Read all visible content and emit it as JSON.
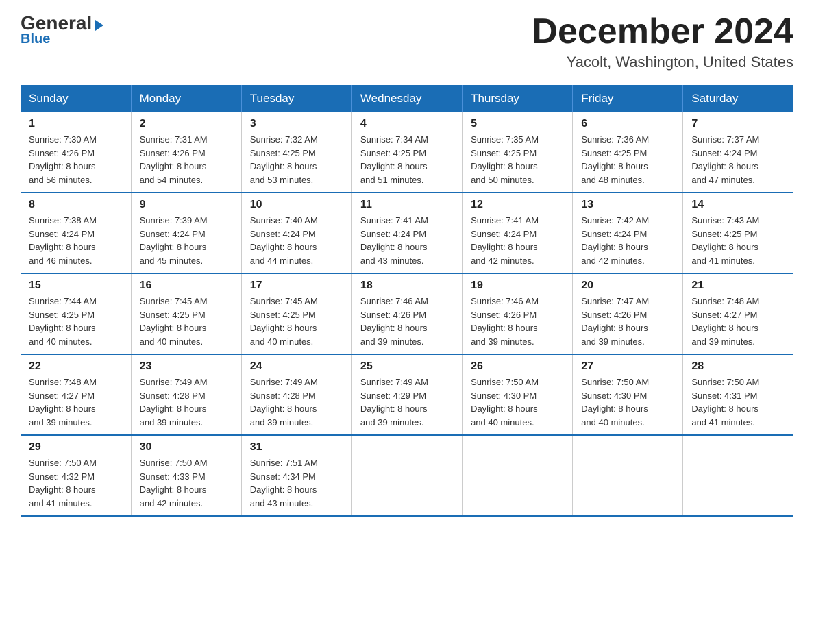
{
  "header": {
    "logo_general": "General",
    "logo_blue": "Blue",
    "month_title": "December 2024",
    "location": "Yacolt, Washington, United States"
  },
  "days_of_week": [
    "Sunday",
    "Monday",
    "Tuesday",
    "Wednesday",
    "Thursday",
    "Friday",
    "Saturday"
  ],
  "weeks": [
    [
      {
        "day": "1",
        "sunrise": "7:30 AM",
        "sunset": "4:26 PM",
        "daylight": "8 hours and 56 minutes."
      },
      {
        "day": "2",
        "sunrise": "7:31 AM",
        "sunset": "4:26 PM",
        "daylight": "8 hours and 54 minutes."
      },
      {
        "day": "3",
        "sunrise": "7:32 AM",
        "sunset": "4:25 PM",
        "daylight": "8 hours and 53 minutes."
      },
      {
        "day": "4",
        "sunrise": "7:34 AM",
        "sunset": "4:25 PM",
        "daylight": "8 hours and 51 minutes."
      },
      {
        "day": "5",
        "sunrise": "7:35 AM",
        "sunset": "4:25 PM",
        "daylight": "8 hours and 50 minutes."
      },
      {
        "day": "6",
        "sunrise": "7:36 AM",
        "sunset": "4:25 PM",
        "daylight": "8 hours and 48 minutes."
      },
      {
        "day": "7",
        "sunrise": "7:37 AM",
        "sunset": "4:24 PM",
        "daylight": "8 hours and 47 minutes."
      }
    ],
    [
      {
        "day": "8",
        "sunrise": "7:38 AM",
        "sunset": "4:24 PM",
        "daylight": "8 hours and 46 minutes."
      },
      {
        "day": "9",
        "sunrise": "7:39 AM",
        "sunset": "4:24 PM",
        "daylight": "8 hours and 45 minutes."
      },
      {
        "day": "10",
        "sunrise": "7:40 AM",
        "sunset": "4:24 PM",
        "daylight": "8 hours and 44 minutes."
      },
      {
        "day": "11",
        "sunrise": "7:41 AM",
        "sunset": "4:24 PM",
        "daylight": "8 hours and 43 minutes."
      },
      {
        "day": "12",
        "sunrise": "7:41 AM",
        "sunset": "4:24 PM",
        "daylight": "8 hours and 42 minutes."
      },
      {
        "day": "13",
        "sunrise": "7:42 AM",
        "sunset": "4:24 PM",
        "daylight": "8 hours and 42 minutes."
      },
      {
        "day": "14",
        "sunrise": "7:43 AM",
        "sunset": "4:25 PM",
        "daylight": "8 hours and 41 minutes."
      }
    ],
    [
      {
        "day": "15",
        "sunrise": "7:44 AM",
        "sunset": "4:25 PM",
        "daylight": "8 hours and 40 minutes."
      },
      {
        "day": "16",
        "sunrise": "7:45 AM",
        "sunset": "4:25 PM",
        "daylight": "8 hours and 40 minutes."
      },
      {
        "day": "17",
        "sunrise": "7:45 AM",
        "sunset": "4:25 PM",
        "daylight": "8 hours and 40 minutes."
      },
      {
        "day": "18",
        "sunrise": "7:46 AM",
        "sunset": "4:26 PM",
        "daylight": "8 hours and 39 minutes."
      },
      {
        "day": "19",
        "sunrise": "7:46 AM",
        "sunset": "4:26 PM",
        "daylight": "8 hours and 39 minutes."
      },
      {
        "day": "20",
        "sunrise": "7:47 AM",
        "sunset": "4:26 PM",
        "daylight": "8 hours and 39 minutes."
      },
      {
        "day": "21",
        "sunrise": "7:48 AM",
        "sunset": "4:27 PM",
        "daylight": "8 hours and 39 minutes."
      }
    ],
    [
      {
        "day": "22",
        "sunrise": "7:48 AM",
        "sunset": "4:27 PM",
        "daylight": "8 hours and 39 minutes."
      },
      {
        "day": "23",
        "sunrise": "7:49 AM",
        "sunset": "4:28 PM",
        "daylight": "8 hours and 39 minutes."
      },
      {
        "day": "24",
        "sunrise": "7:49 AM",
        "sunset": "4:28 PM",
        "daylight": "8 hours and 39 minutes."
      },
      {
        "day": "25",
        "sunrise": "7:49 AM",
        "sunset": "4:29 PM",
        "daylight": "8 hours and 39 minutes."
      },
      {
        "day": "26",
        "sunrise": "7:50 AM",
        "sunset": "4:30 PM",
        "daylight": "8 hours and 40 minutes."
      },
      {
        "day": "27",
        "sunrise": "7:50 AM",
        "sunset": "4:30 PM",
        "daylight": "8 hours and 40 minutes."
      },
      {
        "day": "28",
        "sunrise": "7:50 AM",
        "sunset": "4:31 PM",
        "daylight": "8 hours and 41 minutes."
      }
    ],
    [
      {
        "day": "29",
        "sunrise": "7:50 AM",
        "sunset": "4:32 PM",
        "daylight": "8 hours and 41 minutes."
      },
      {
        "day": "30",
        "sunrise": "7:50 AM",
        "sunset": "4:33 PM",
        "daylight": "8 hours and 42 minutes."
      },
      {
        "day": "31",
        "sunrise": "7:51 AM",
        "sunset": "4:34 PM",
        "daylight": "8 hours and 43 minutes."
      },
      null,
      null,
      null,
      null
    ]
  ],
  "labels": {
    "sunrise_prefix": "Sunrise: ",
    "sunset_prefix": "Sunset: ",
    "daylight_prefix": "Daylight: "
  }
}
